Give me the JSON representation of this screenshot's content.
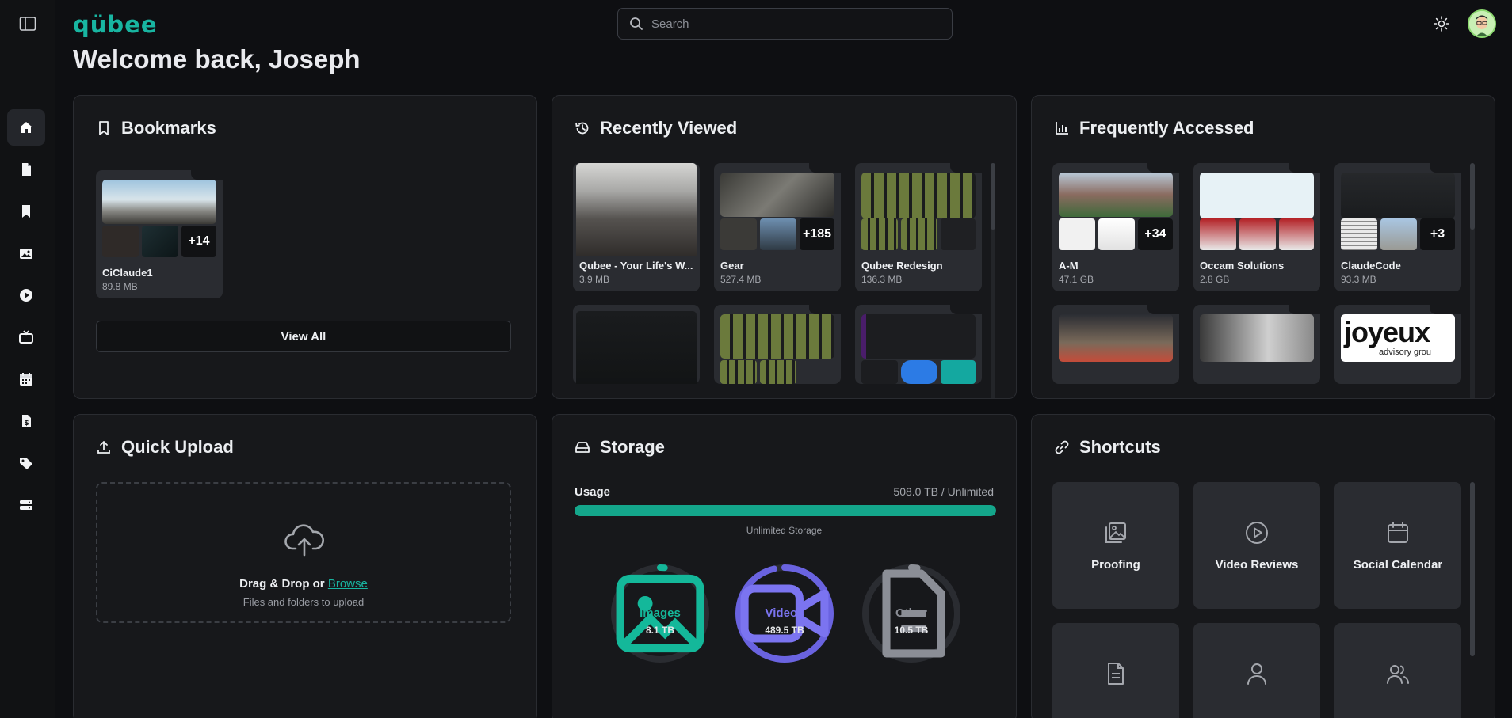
{
  "app": {
    "logo": "qübee",
    "welcome": "Welcome back, Joseph"
  },
  "search": {
    "placeholder": "Search"
  },
  "panels": {
    "bookmarks": {
      "title": "Bookmarks",
      "view_all": "View All",
      "folders": [
        {
          "name": "CiClaude1",
          "size": "89.8 MB",
          "more": "+14"
        }
      ]
    },
    "recent": {
      "title": "Recently Viewed",
      "folders": [
        {
          "name": "Qubee - Your Life's W...",
          "size": "3.9 MB"
        },
        {
          "name": "Gear",
          "size": "527.4 MB",
          "more": "+185"
        },
        {
          "name": "Qubee Redesign",
          "size": "136.3 MB"
        }
      ]
    },
    "frequent": {
      "title": "Frequently Accessed",
      "folders": [
        {
          "name": "A-M",
          "size": "47.1 GB",
          "more": "+34"
        },
        {
          "name": "Occam Solutions",
          "size": "2.8 GB"
        },
        {
          "name": "ClaudeCode",
          "size": "93.3 MB",
          "more": "+3"
        }
      ],
      "peek_logo": {
        "word": "joyeux",
        "tag": "advisory grou"
      }
    },
    "upload": {
      "title": "Quick Upload",
      "drag_text": "Drag & Drop or ",
      "browse": "Browse",
      "hint": "Files and folders to upload"
    },
    "storage": {
      "title": "Storage",
      "usage_label": "Usage",
      "usage_value": "508.0 TB / Unlimited",
      "usage_fraction": 1.0,
      "usage_note": "Unlimited Storage",
      "rings": [
        {
          "label": "Images",
          "value": "8.1 TB",
          "fraction": 0.016,
          "color": "#14b89a"
        },
        {
          "label": "Videos",
          "value": "489.5 TB",
          "fraction": 0.963,
          "color": "#6a63e0"
        },
        {
          "label": "Other",
          "value": "10.5 TB",
          "fraction": 0.021,
          "color": "#8b8e96"
        }
      ]
    },
    "shortcuts": {
      "title": "Shortcuts",
      "items": [
        {
          "label": "Proofing"
        },
        {
          "label": "Video Reviews"
        },
        {
          "label": "Social Calendar"
        }
      ]
    }
  },
  "colors": {
    "accent": "#18b5a1",
    "panel": "#17181b",
    "card": "#2a2c31"
  }
}
